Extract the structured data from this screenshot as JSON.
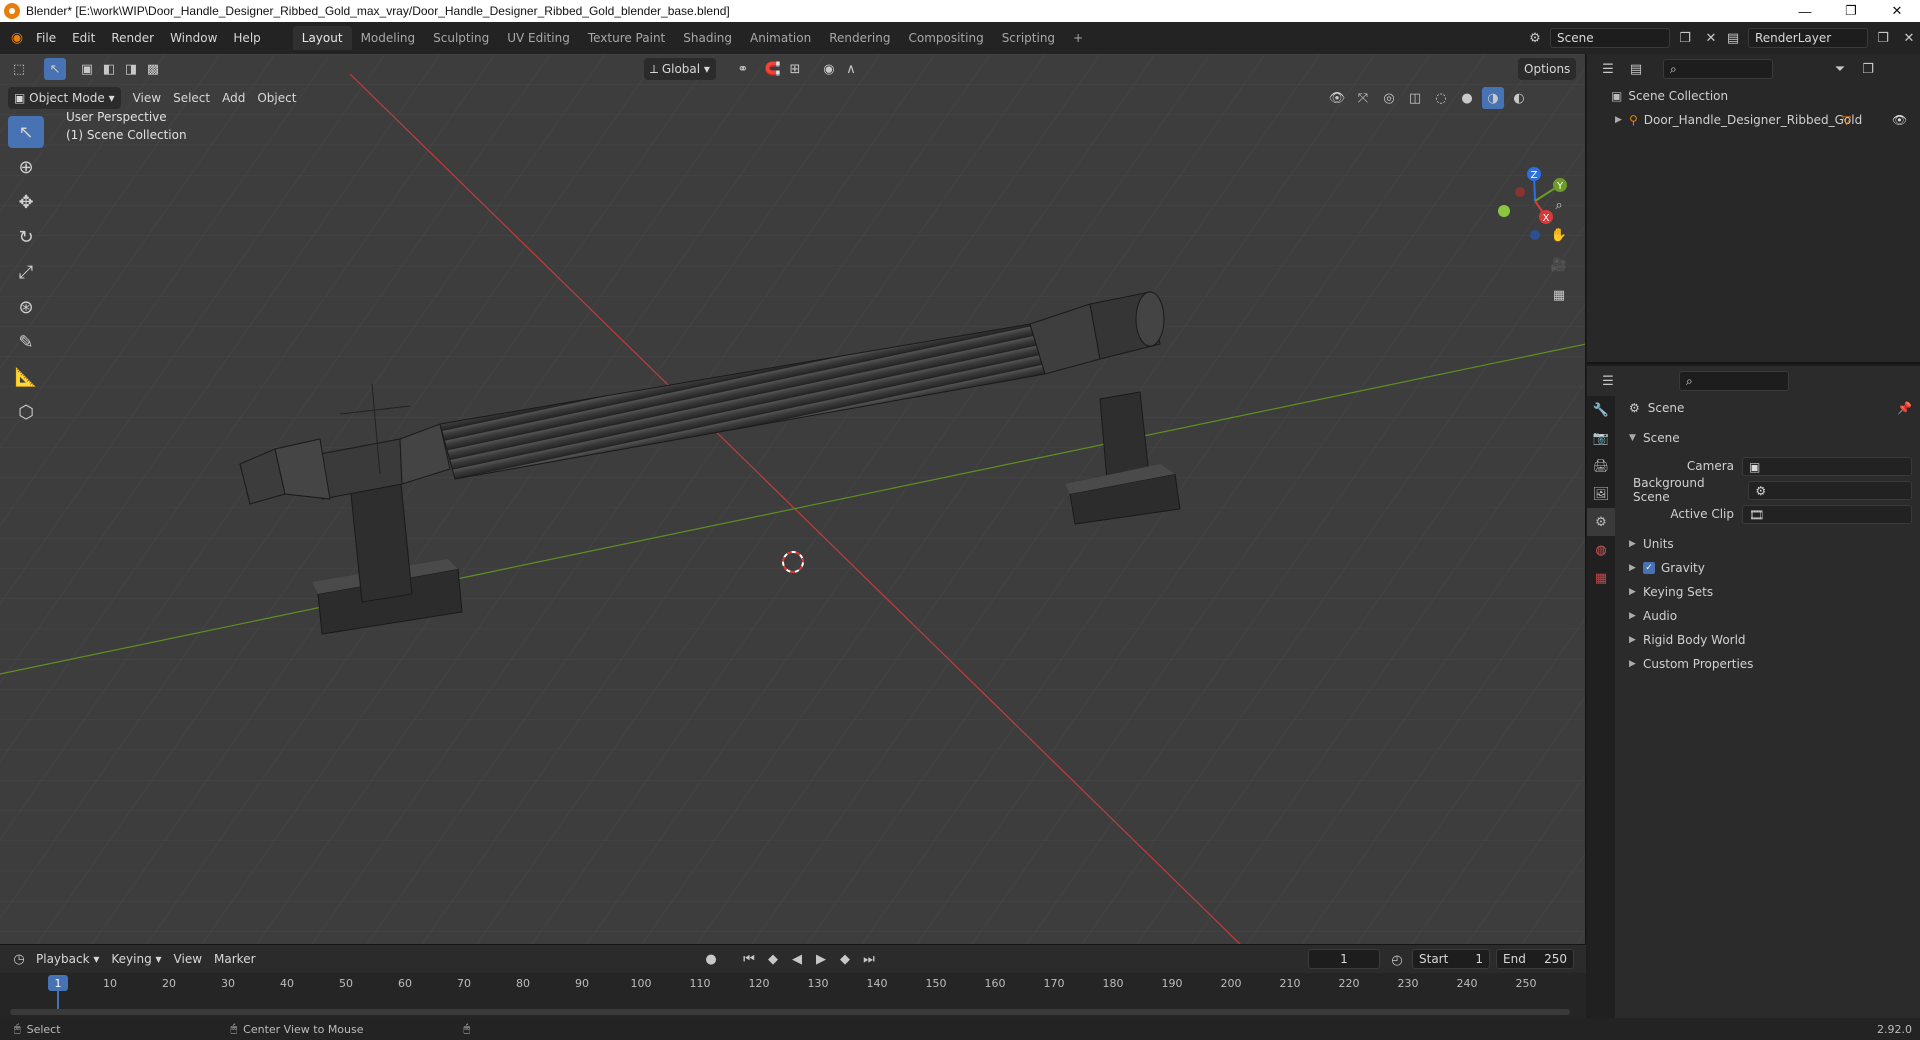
{
  "window": {
    "title": "Blender* [E:\\work\\WIP\\Door_Handle_Designer_Ribbed_Gold_max_vray/Door_Handle_Designer_Ribbed_Gold_blender_base.blend]",
    "minimize": "—",
    "maximize": "❐",
    "close": "✕"
  },
  "menu": {
    "items": [
      "File",
      "Edit",
      "Render",
      "Window",
      "Help"
    ]
  },
  "workspaces": {
    "tabs": [
      "Layout",
      "Modeling",
      "Sculpting",
      "UV Editing",
      "Texture Paint",
      "Shading",
      "Animation",
      "Rendering",
      "Compositing",
      "Scripting"
    ],
    "active": "Layout",
    "add": "+"
  },
  "topright": {
    "scene": "Scene",
    "render_layer": "RenderLayer"
  },
  "viewport": {
    "mode": "Object Mode",
    "menus": [
      "View",
      "Select",
      "Add",
      "Object"
    ],
    "orientation": "Global",
    "options": "Options",
    "perspective": "User Perspective",
    "collection": "(1) Scene Collection",
    "axis_labels": {
      "x": "X",
      "y": "Y",
      "z": "Z"
    }
  },
  "outliner": {
    "root": "Scene Collection",
    "object": "Door_Handle_Designer_Ribbed_Gold"
  },
  "properties": {
    "context": "Scene",
    "section": "Scene",
    "fields": [
      {
        "label": "Camera",
        "value": ""
      },
      {
        "label": "Background Scene",
        "value": ""
      },
      {
        "label": "Active Clip",
        "value": ""
      }
    ],
    "panels": [
      "Units",
      "Gravity",
      "Keying Sets",
      "Audio",
      "Rigid Body World",
      "Custom Properties"
    ],
    "gravity_checked": true
  },
  "timeline": {
    "menus": [
      "Playback",
      "Keying",
      "View",
      "Marker"
    ],
    "current_frame": "1",
    "start_label": "Start",
    "start": "1",
    "end_label": "End",
    "end": "250",
    "ruler": [
      "1",
      "10",
      "20",
      "30",
      "40",
      "50",
      "60",
      "70",
      "80",
      "90",
      "100",
      "110",
      "120",
      "130",
      "140",
      "150",
      "160",
      "170",
      "180",
      "190",
      "200",
      "210",
      "220",
      "230",
      "240",
      "250"
    ]
  },
  "status": {
    "select": "Select",
    "center_view": "Center View to Mouse",
    "version": "2.92.0"
  },
  "colors": {
    "accent": "#4772b3",
    "x_axis": "#d83a3a",
    "y_axis": "#6d9b28",
    "z_axis": "#2f6fe0",
    "orange": "#e87d0d"
  }
}
